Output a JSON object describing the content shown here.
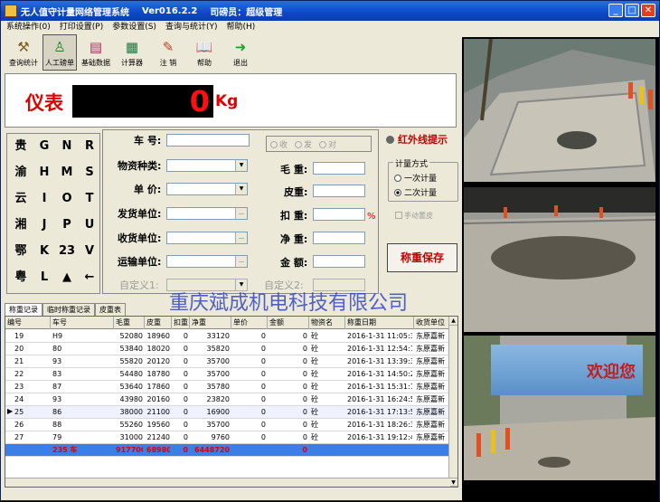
{
  "window": {
    "title_app": "无人值守计量网络管理系统",
    "title_version": "Ver016.2.2",
    "title_user": "司磅员：超级管理"
  },
  "menu": [
    "系统操作(0)",
    "打印设置(P)",
    "参数设置(S)",
    "查询与统计(Y)",
    "帮助(H)"
  ],
  "toolbar": [
    "查询统计",
    "人工磅单",
    "基础数据",
    "计算器",
    "注 销",
    "帮助",
    "退出"
  ],
  "display": {
    "label": "仪表",
    "weight": "0",
    "unit": "Kg"
  },
  "keypad": {
    "col1": [
      "贵",
      "渝",
      "云",
      "湘",
      "鄂",
      "粤"
    ],
    "col2": [
      "G",
      "H",
      "I",
      "J",
      "K",
      "L"
    ],
    "col3": [
      "N",
      "M",
      "O",
      "P",
      "23",
      "▲"
    ],
    "col4": [
      "R",
      "S",
      "T",
      "U",
      "V",
      "←"
    ]
  },
  "form": {
    "plate_label": "车  号:",
    "material_label": "物资种类:",
    "price_label": "单  价:",
    "sender_label": "发货单位:",
    "receiver_label": "收货单位:",
    "transport_label": "运输单位:",
    "custom1_label": "自定义1:",
    "gross_label": "毛  重:",
    "tare_label": "皮重:",
    "deduct_label": "扣  重:",
    "net_label": "净  重:",
    "amount_label": "金  额:",
    "custom2_label": "自定义2:",
    "radio": [
      "收",
      "发",
      "对"
    ],
    "deduct_unit": "%"
  },
  "side": {
    "infrared": "红外线提示",
    "group_title": "计量方式",
    "opt1": "一次计量",
    "opt2": "二次计量",
    "manual": "手动置皮",
    "save": "称重保存"
  },
  "watermark": "重庆斌成机电科技有限公司",
  "tabs": [
    "称重记录",
    "临时称重记录",
    "皮重表"
  ],
  "table": {
    "headers": [
      "编号",
      "车号",
      "毛重",
      "皮重",
      "扣重",
      "净重",
      "单价",
      "金额",
      "物资名",
      "称重日期",
      "收货单位"
    ],
    "rows": [
      [
        "19",
        "H9",
        "52080",
        "18960",
        "0",
        "33120",
        "0",
        "0",
        "砼",
        "2016-1-31 11:05:36",
        "东原嘉新"
      ],
      [
        "20",
        "80",
        "53840",
        "18020",
        "0",
        "35820",
        "0",
        "0",
        "砼",
        "2016-1-31 12:54:15",
        "东原嘉新"
      ],
      [
        "21",
        "93",
        "55820",
        "20120",
        "0",
        "35700",
        "0",
        "0",
        "砼",
        "2016-1-31 13:39:35",
        "东原嘉新"
      ],
      [
        "22",
        "83",
        "54480",
        "18780",
        "0",
        "35700",
        "0",
        "0",
        "砼",
        "2016-1-31 14:50:20",
        "东原嘉新"
      ],
      [
        "23",
        "87",
        "53640",
        "17860",
        "0",
        "35780",
        "0",
        "0",
        "砼",
        "2016-1-31 15:31:13",
        "东原嘉新"
      ],
      [
        "24",
        "93",
        "43980",
        "20160",
        "0",
        "23820",
        "0",
        "0",
        "砼",
        "2016-1-31 16:24:51",
        "东原嘉新"
      ],
      [
        "25",
        "86",
        "38000",
        "21100",
        "0",
        "16900",
        "0",
        "0",
        "砼",
        "2016-1-31 17:13:53",
        "东原嘉新"
      ],
      [
        "26",
        "88",
        "55260",
        "19560",
        "0",
        "35700",
        "0",
        "0",
        "砼",
        "2016-1-31 18:26:36",
        "东原嘉新"
      ],
      [
        "27",
        "79",
        "31000",
        "21240",
        "0",
        "9760",
        "0",
        "0",
        "砼",
        "2016-1-31 19:12:43",
        "东原嘉新"
      ]
    ],
    "selected_index": 6,
    "summary": [
      "",
      "235 车",
      "917700",
      "68980",
      "0",
      "6448720",
      "",
      "0",
      "",
      "",
      ""
    ]
  },
  "cameras": {
    "banner_text": "欢迎您"
  }
}
